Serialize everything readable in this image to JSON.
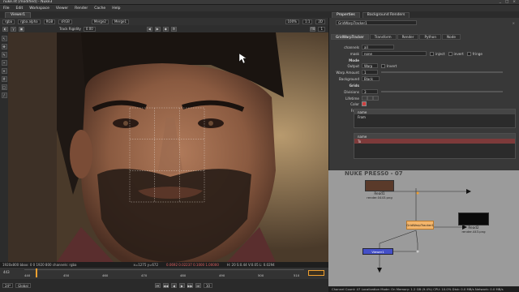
{
  "window": {
    "title": "nuke.nt [modified] - Nuke3",
    "controls": [
      "_",
      "□",
      "×"
    ]
  },
  "menu": [
    "File",
    "Edit",
    "Workspace",
    "Viewer",
    "Render",
    "Cache",
    "Help"
  ],
  "viewer_tab": "Viewer1",
  "viewer_toolbar": {
    "layer": "rgba",
    "channel": "rgba.alpha",
    "colorspace": "RGB",
    "lut": "sRGB",
    "input_a": "Merge2",
    "input_b": "Merge1",
    "zoom": "100%",
    "ratio": "1:1",
    "mode": "2D"
  },
  "viewer_toolbar2": {
    "track_label": "Track Rigidity",
    "track_value": "0.00",
    "f_label": "f/8",
    "frame": "1"
  },
  "viewer_status": {
    "format": "1920x800  bbox: 0 0 1920 800  channels: rgba",
    "coords": "x=1275 y=672",
    "rgba": "0.0692  0.02237  0.1000  1.00000",
    "hsvl": "H: 20  S:0.44  V:0.05  L: 0.0294"
  },
  "timeline": {
    "fps": "24*",
    "tc": "Global",
    "ticks": [
      "440",
      "450",
      "460",
      "470",
      "480",
      "490",
      "500",
      "510"
    ],
    "current_frame": "443",
    "step": "10"
  },
  "panel_tabs": [
    "Properties",
    "Background Renders"
  ],
  "properties": {
    "node_name": "GridWarpTracker1",
    "tabs": [
      "GridWarpTracker",
      "Transform",
      "Render",
      "Python",
      "Node"
    ],
    "channels_label": "channels",
    "channels_value": "all",
    "mask_label": "mask",
    "mask_value": "none",
    "inject_label": "inject",
    "invert_label": "invert",
    "fringe_label": "fringe",
    "mode_section": "Mode",
    "output_label": "Output",
    "output_value": "Warp",
    "invert2_label": "Invert",
    "warp_amount_label": "Warp Amount",
    "warp_amount_value": "1",
    "background_label": "Background",
    "background_value": "Black",
    "grids_section": "Grids",
    "divisions_label": "Divisions",
    "divisions_value": "3",
    "lifetime_label": "Lifetime",
    "color_label": "Color",
    "from_label": "From",
    "from_header": "name",
    "from_rows": [
      "From"
    ],
    "to_label": "To",
    "to_header": "name",
    "to_rows": [
      "To"
    ]
  },
  "node_graph": {
    "backdrop_title": "NUKE PRESS0 - 07",
    "nodes": [
      {
        "name": "Read1",
        "file": "render.0443.png"
      },
      {
        "name": "GridWarpTracker1"
      },
      {
        "name": "Read2",
        "file": "render.443.png"
      },
      {
        "name": "Viewer1"
      }
    ]
  },
  "bottom_status": "Channel Count: 47  Localization Mode: On  Memory: 1.2 GB (9.4%)  CPU: 10.0%  Disk: 0.0 MB/s  Network: 0.0 MB/s",
  "colors": {
    "accent": "#f0a030",
    "selected_row": "#7d3a3a",
    "node_graph_bg": "#9b9b9b"
  }
}
